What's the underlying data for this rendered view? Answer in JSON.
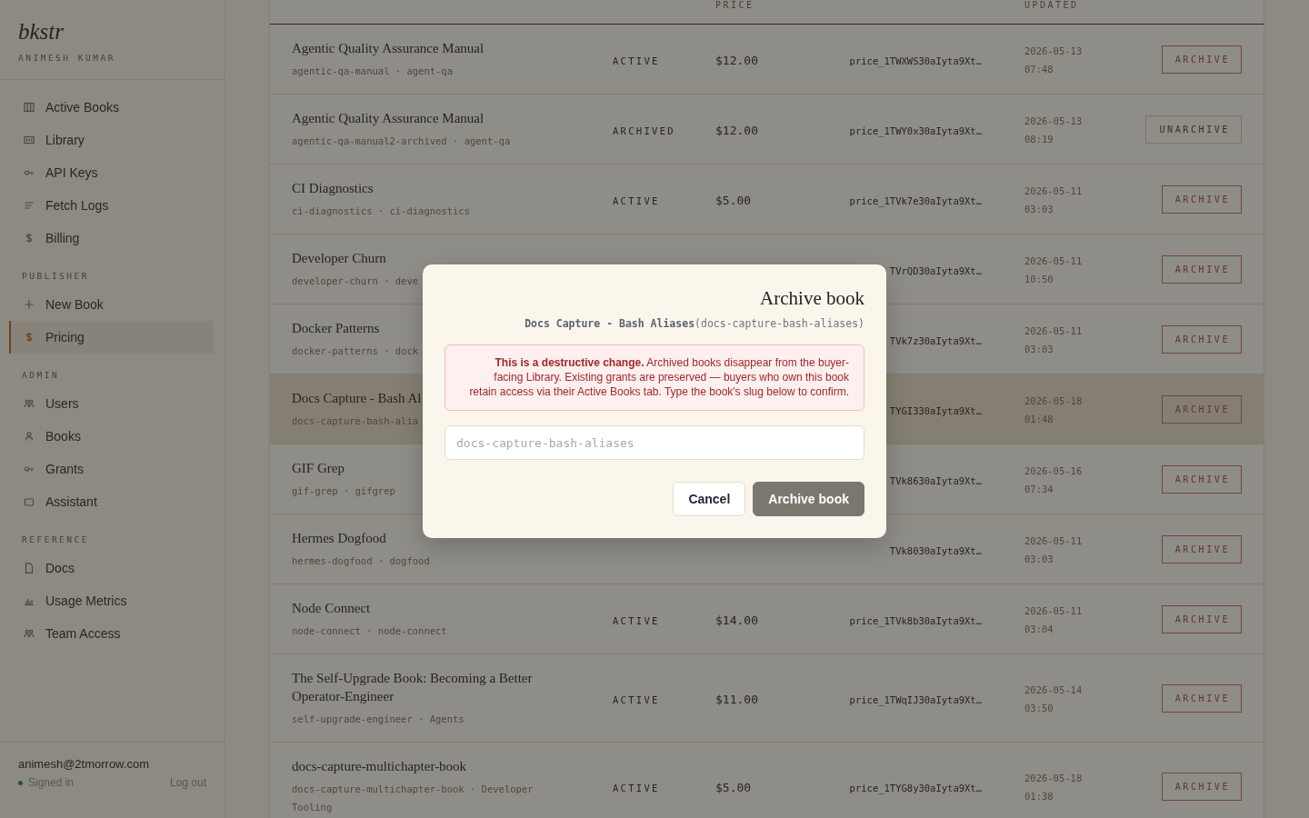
{
  "sidebar": {
    "logo": "bkstr",
    "account": "ANIMESH KUMAR",
    "sections": [
      {
        "items": [
          {
            "label": "Active Books",
            "selected": false
          },
          {
            "label": "Library",
            "selected": false
          },
          {
            "label": "API Keys",
            "selected": false
          },
          {
            "label": "Fetch Logs",
            "selected": false
          },
          {
            "label": "Billing",
            "selected": false
          }
        ]
      },
      {
        "title": "PUBLISHER",
        "items": [
          {
            "label": "New Book",
            "selected": false
          },
          {
            "label": "Pricing",
            "selected": true
          }
        ]
      },
      {
        "title": "ADMIN",
        "items": [
          {
            "label": "Users",
            "selected": false
          },
          {
            "label": "Books",
            "selected": false
          },
          {
            "label": "Grants",
            "selected": false
          },
          {
            "label": "Assistant",
            "selected": false
          }
        ]
      },
      {
        "title": "REFERENCE",
        "items": [
          {
            "label": "Docs",
            "selected": false
          },
          {
            "label": "Usage Metrics",
            "selected": false
          },
          {
            "label": "Team Access",
            "selected": false
          }
        ]
      }
    ],
    "footer": {
      "email": "animesh@2tmorrow.com",
      "status": "Signed in",
      "signed_in": true,
      "logout": "Log out"
    }
  },
  "table": {
    "columns": [
      {
        "label": "PRICE",
        "kind": "price"
      },
      {
        "label": "UPDATED",
        "kind": "updated"
      }
    ],
    "rows": [
      {
        "title": "Agentic Quality Assurance Manual",
        "slug_line": "agentic-qa-manual · agent-qa",
        "status": "ACTIVE",
        "price": "$12.00",
        "price_id": "price_1TWXWS30aIyta9Xt…",
        "date": "2026-05-13",
        "time": "07:48",
        "action": {
          "label": "ARCHIVE",
          "kind": "archive"
        },
        "selected": false
      },
      {
        "title": "Agentic Quality Assurance Manual",
        "slug_line": "agentic-qa-manual2-archived · agent-qa",
        "status": "ARCHIVED",
        "price": "$12.00",
        "price_id": "price_1TWY0x30aIyta9Xt…",
        "date": "2026-05-13",
        "time": "08:19",
        "action": {
          "label": "UNARCHIVE",
          "kind": "unarchive"
        },
        "selected": false
      },
      {
        "title": "CI Diagnostics",
        "slug_line": "ci-diagnostics · ci-diagnostics",
        "status": "ACTIVE",
        "price": "$5.00",
        "price_id": "price_1TVk7e30aIyta9Xt…",
        "date": "2026-05-11",
        "time": "03:03",
        "action": {
          "label": "ARCHIVE",
          "kind": "archive"
        },
        "selected": false
      },
      {
        "title": "Developer Churn",
        "slug_line": "developer-churn · deve",
        "price_id": "TVrQD30aIyta9Xt…",
        "date": "2026-05-11",
        "time": "10:50",
        "action": {
          "label": "ARCHIVE",
          "kind": "archive"
        },
        "selected": false
      },
      {
        "title": "Docker Patterns",
        "slug_line": "docker-patterns · dock",
        "price_id": "TVk7z30aIyta9Xt…",
        "date": "2026-05-11",
        "time": "03:03",
        "action": {
          "label": "ARCHIVE",
          "kind": "archive"
        },
        "selected": false
      },
      {
        "title": "Docs Capture - Bash Al",
        "slug_line": "docs-capture-bash-alia",
        "price_id": "TYGI330aIyta9Xt…",
        "date": "2026-05-18",
        "time": "01:48",
        "action": {
          "label": "ARCHIVE",
          "kind": "archive"
        },
        "selected": true
      },
      {
        "title": "GIF Grep",
        "slug_line": "gif-grep · gifgrep",
        "price_id": "TVk8630aIyta9Xt…",
        "date": "2026-05-16",
        "time": "07:34",
        "action": {
          "label": "ARCHIVE",
          "kind": "archive"
        },
        "selected": false
      },
      {
        "title": "Hermes Dogfood",
        "slug_line": "hermes-dogfood · dogfood",
        "price_id": "TVk8030aIyta9Xt…",
        "date": "2026-05-11",
        "time": "03:03",
        "action": {
          "label": "ARCHIVE",
          "kind": "archive"
        },
        "selected": false
      },
      {
        "title": "Node Connect",
        "slug_line": "node-connect · node-connect",
        "status": "ACTIVE",
        "price": "$14.00",
        "price_id": "price_1TVk8b30aIyta9Xt…",
        "date": "2026-05-11",
        "time": "03:04",
        "action": {
          "label": "ARCHIVE",
          "kind": "archive"
        },
        "selected": false
      },
      {
        "title": "The Self-Upgrade Book: Becoming a Better Operator-Engineer",
        "slug_line": "self-upgrade-engineer · Agents",
        "status": "ACTIVE",
        "price": "$11.00",
        "price_id": "price_1TWqIJ30aIyta9Xt…",
        "date": "2026-05-14",
        "time": "03:50",
        "action": {
          "label": "ARCHIVE",
          "kind": "archive"
        },
        "selected": false
      },
      {
        "title": "docs-capture-multichapter-book",
        "slug_line": "docs-capture-multichapter-book · Developer Tooling",
        "status": "ACTIVE",
        "price": "$5.00",
        "price_id": "price_1TYG8y30aIyta9Xt…",
        "date": "2026-05-18",
        "time": "01:38",
        "action": {
          "label": "ARCHIVE",
          "kind": "archive"
        },
        "selected": false
      }
    ]
  },
  "modal": {
    "title": "Archive book",
    "subtitle": "**Docs Capture - Bash Aliases**(docs-capture-bash-aliases)",
    "warning": "**This is a destructive change.** Archived books disappear from the buyer-facing Library. Existing grants are preserved — buyers who own this book retain access via their Active Books tab. Type the book's slug below to confirm.",
    "input": {
      "placeholder": "docs-capture-bash-aliases"
    },
    "buttons": [
      {
        "label": "Cancel",
        "kind": "secondary",
        "disabled": false
      },
      {
        "label": "Archive book",
        "kind": "primary",
        "disabled": true
      }
    ]
  }
}
